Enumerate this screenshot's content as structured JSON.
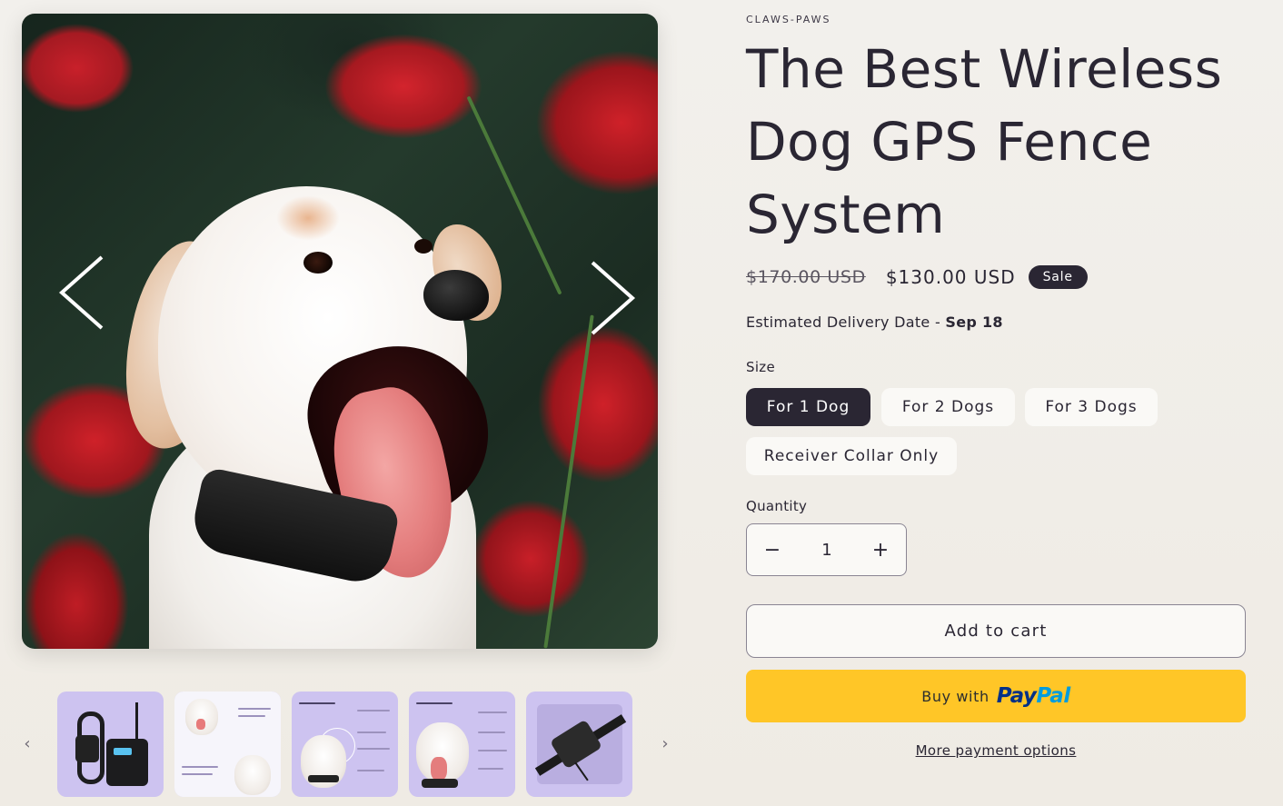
{
  "product": {
    "vendor": "CLAWS-PAWS",
    "title": "The Best Wireless Dog GPS Fence System",
    "price": {
      "regular": "$170.00 USD",
      "sale": "$130.00 USD",
      "badge": "Sale"
    },
    "delivery": {
      "label": "Estimated Delivery Date - ",
      "date": "Sep 18"
    },
    "size": {
      "label": "Size",
      "options": [
        "For 1 Dog",
        "For 2 Dogs",
        "For 3 Dogs",
        "Receiver Collar Only"
      ],
      "selected": "For 1 Dog"
    },
    "quantity": {
      "label": "Quantity",
      "value": "1",
      "minus": "−",
      "plus": "+"
    },
    "buttons": {
      "add_to_cart": "Add to cart",
      "paypal_prefix": "Buy with",
      "paypal_brand_1": "Pay",
      "paypal_brand_2": "Pal",
      "more_payment": "More payment options"
    }
  },
  "gallery": {
    "main_image": "dog-with-red-flowers",
    "prev_icon": "chevron-left-icon",
    "next_icon": "chevron-right-icon",
    "thumbnails": [
      {
        "name": "thumb-collar-remote"
      },
      {
        "name": "thumb-wireless-fence-mode"
      },
      {
        "name": "thumb-wireless-fence-mode-2"
      },
      {
        "name": "thumb-training-collar-mode"
      },
      {
        "name": "thumb-collar-closeup"
      }
    ]
  },
  "colors": {
    "accent_dark": "#2a2633",
    "paypal_yellow": "#ffc627",
    "thumb_bg": "#cdc3f0"
  }
}
